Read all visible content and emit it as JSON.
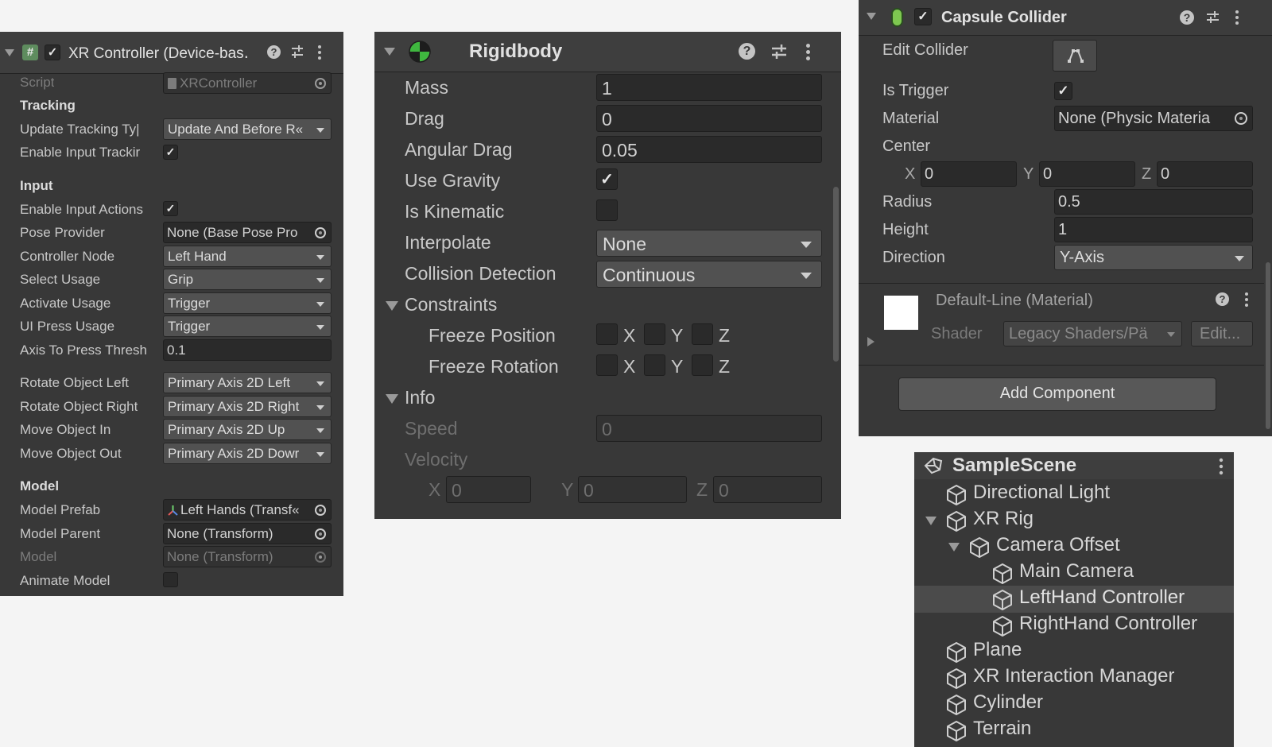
{
  "xr": {
    "title": "XR Controller (Device-bas․",
    "script_label": "Script",
    "script_value": "XRController",
    "tracking_header": "Tracking",
    "update_tracking_label": "Update Tracking Ty|",
    "update_tracking_value": "Update And Before R«",
    "enable_input_tracking_label": "Enable Input Trackir",
    "input_header": "Input",
    "enable_input_actions_label": "Enable Input Actions",
    "pose_provider_label": "Pose Provider",
    "pose_provider_value": "None (Base Pose Pro",
    "controller_node_label": "Controller Node",
    "controller_node_value": "Left Hand",
    "select_usage_label": "Select Usage",
    "select_usage_value": "Grip",
    "activate_usage_label": "Activate Usage",
    "activate_usage_value": "Trigger",
    "ui_press_label": "UI Press Usage",
    "ui_press_value": "Trigger",
    "axis_press_label": "Axis To Press Thresh",
    "axis_press_value": "0.1",
    "rotate_left_label": "Rotate Object Left",
    "rotate_left_value": "Primary Axis 2D Left",
    "rotate_right_label": "Rotate Object Right",
    "rotate_right_value": "Primary Axis 2D Right",
    "move_in_label": "Move Object In",
    "move_in_value": "Primary Axis 2D Up",
    "move_out_label": "Move Object Out",
    "move_out_value": "Primary Axis 2D Dowr",
    "model_header": "Model",
    "model_prefab_label": "Model Prefab",
    "model_prefab_value": "Left Hands (Transf«",
    "model_parent_label": "Model Parent",
    "model_parent_value": "None (Transform)",
    "model_label": "Model",
    "model_value": "None (Transform)",
    "animate_model_label": "Animate Model"
  },
  "rigidbody": {
    "title": "Rigidbody",
    "mass_label": "Mass",
    "mass_value": "1",
    "drag_label": "Drag",
    "drag_value": "0",
    "angular_drag_label": "Angular Drag",
    "angular_drag_value": "0.05",
    "use_gravity_label": "Use Gravity",
    "is_kinematic_label": "Is Kinematic",
    "interpolate_label": "Interpolate",
    "interpolate_value": "None",
    "collision_label": "Collision Detection",
    "collision_value": "Continuous",
    "constraints_label": "Constraints",
    "freeze_position_label": "Freeze Position",
    "freeze_rotation_label": "Freeze Rotation",
    "axis_x": "X",
    "axis_y": "Y",
    "axis_z": "Z",
    "info_label": "Info",
    "speed_label": "Speed",
    "speed_value": "0",
    "velocity_label": "Velocity",
    "vel_x": "0",
    "vel_y": "0",
    "vel_z": "0"
  },
  "capsule": {
    "title": "Capsule Collider",
    "edit_collider_label": "Edit Collider",
    "is_trigger_label": "Is Trigger",
    "material_label": "Material",
    "material_value": "None (Physic Materia",
    "center_label": "Center",
    "axis_x": "X",
    "axis_y": "Y",
    "axis_z": "Z",
    "center_x": "0",
    "center_y": "0",
    "center_z": "0",
    "radius_label": "Radius",
    "radius_value": "0.5",
    "height_label": "Height",
    "height_value": "1",
    "direction_label": "Direction",
    "direction_value": "Y-Axis",
    "material_name": "Default-Line (Material)",
    "shader_label": "Shader",
    "shader_value": "Legacy Shaders/Pä",
    "edit_button": "Edit...",
    "add_component": "Add Component"
  },
  "hierarchy": {
    "scene": "SampleScene",
    "items": [
      "Directional Light",
      "XR Rig",
      "Camera Offset",
      "Main Camera",
      "LeftHand Controller",
      "RightHand Controller",
      "Plane",
      "XR Interaction Manager",
      "Cylinder",
      "Terrain"
    ]
  },
  "colors": {
    "panel": "#383838",
    "header": "#3e3e3e",
    "field": "#2a2a2a",
    "dropdown": "#515151",
    "selected_row": "#4b4b4b",
    "rigidbody_icon_green": "#3fb73f",
    "capsule_icon_green": "#7ec850"
  },
  "icons": [
    "script-hash-icon",
    "rigidbody-icon",
    "capsule-collider-icon",
    "help-icon",
    "preset-sliders-icon",
    "kebab-menu-icon",
    "object-picker-icon",
    "edit-collider-icon",
    "unity-scene-icon",
    "gameobject-cube-icon",
    "dropdown-caret-icon",
    "foldout-arrow-icon"
  ]
}
